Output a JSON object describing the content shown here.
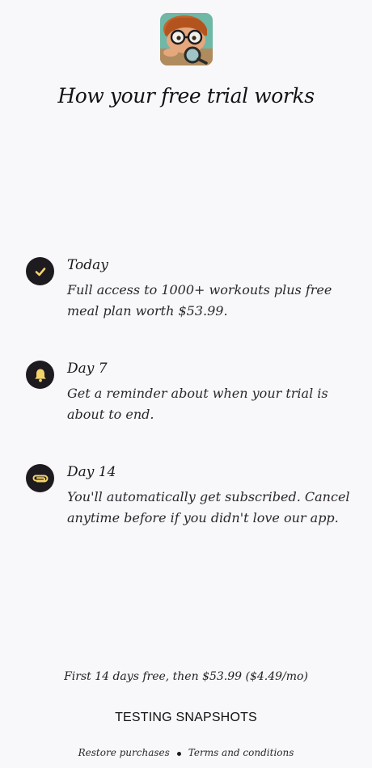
{
  "header": {
    "app_icon": "cartoon-boy-with-glasses-and-magnifier-icon",
    "title": "How your free trial works"
  },
  "steps": [
    {
      "icon": "checkmark-icon",
      "title": "Today",
      "description": "Full access to 1000+ workouts plus free meal plan worth $53.99."
    },
    {
      "icon": "bell-icon",
      "title": "Day 7",
      "description": "Get a reminder about when your trial is about to end."
    },
    {
      "icon": "paperclip-icon",
      "title": "Day 14",
      "description": "You'll automatically get subscribed. Cancel anytime before if you didn't love our app."
    }
  ],
  "pricing": {
    "text": "First 14 days free, then $53.99 ($4.49/mo)"
  },
  "cta": {
    "label": "TESTING SNAPSHOTS"
  },
  "footer": {
    "restore_label": "Restore purchases",
    "terms_label": "Terms and conditions"
  },
  "colors": {
    "background": "#f8f7f9",
    "badge": "#1d1b1f",
    "accent_icon": "#f3d46a"
  }
}
